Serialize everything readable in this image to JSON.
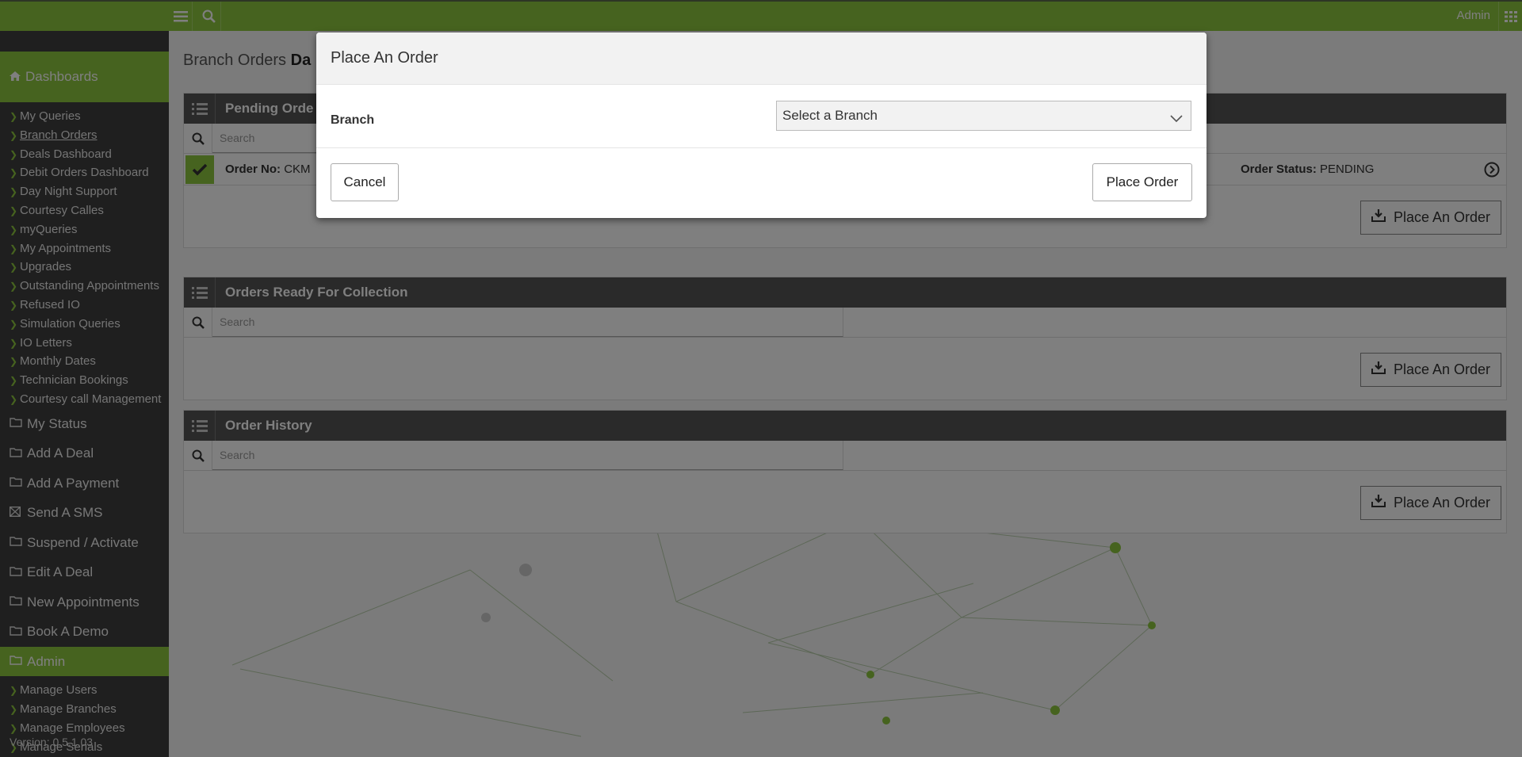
{
  "topbar": {
    "admin_label": "Admin"
  },
  "sidebar": {
    "dashboards_label": "Dashboards",
    "dash_items": [
      "My Queries",
      "Branch Orders",
      "Deals Dashboard",
      "Debit Orders Dashboard",
      "Day Night Support",
      "Courtesy Calles",
      "myQueries",
      "My Appointments",
      "Upgrades",
      "Outstanding Appointments",
      "Refused IO",
      "Simulation Queries",
      "IO Letters",
      "Monthly Dates",
      "Technician Bookings",
      "Courtesy call Management"
    ],
    "main_items": [
      "My Status",
      "Add A Deal",
      "Add A Payment",
      "Send A SMS",
      "Suspend / Activate",
      "Edit A Deal",
      "New Appointments",
      "Book A Demo"
    ],
    "admin_label": "Admin",
    "admin_items": [
      "Manage Users",
      "Manage Branches",
      "Manage Employees",
      "Manage Serials"
    ],
    "version": "Version: 0.5.1.03"
  },
  "page": {
    "title_prefix": "Branch Orders",
    "title_bold": "Da"
  },
  "panels": {
    "pending": {
      "title": "Pending Orde",
      "search_placeholder": "Search",
      "order_no_label": "Order No:",
      "order_no_value": "CKM",
      "order_status_label": "Order Status:",
      "order_status_value": "PENDING",
      "place_label": "Place An Order"
    },
    "ready": {
      "title": "Orders Ready For Collection",
      "search_placeholder": "Search",
      "place_label": "Place An Order"
    },
    "history": {
      "title": "Order History",
      "search_placeholder": "Search",
      "place_label": "Place An Order"
    }
  },
  "modal": {
    "title": "Place An Order",
    "branch_label": "Branch",
    "select_value": "Select a Branch",
    "cancel_label": "Cancel",
    "submit_label": "Place Order"
  },
  "colors": {
    "accent": "#8cc63f",
    "sidebar": "#3f3f3f",
    "panel_head": "#555555"
  },
  "icons": [
    "menu-icon",
    "search-icon",
    "apps-grid-icon",
    "home-icon",
    "chevron-right-icon",
    "folder-icon",
    "envelope-icon",
    "list-icon",
    "check-icon",
    "circle-arrow-icon",
    "download-icon",
    "chevron-down-icon"
  ]
}
